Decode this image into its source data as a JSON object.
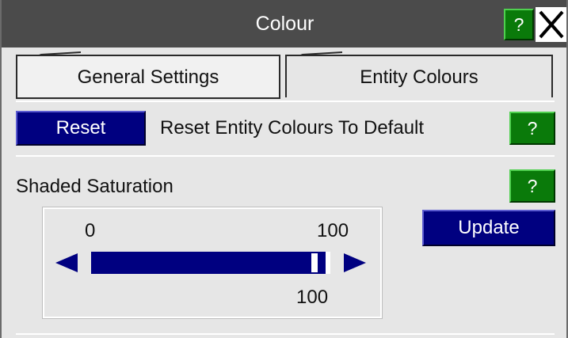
{
  "window": {
    "title": "Colour",
    "help_label": "?",
    "close_icon": "close-icon"
  },
  "tabs": [
    {
      "label": "General Settings",
      "active": false
    },
    {
      "label": "Entity Colours",
      "active": true
    }
  ],
  "reset_row": {
    "button_label": "Reset",
    "description": "Reset Entity Colours To Default",
    "help_label": "?"
  },
  "shaded": {
    "label": "Shaded Saturation",
    "help_label": "?",
    "update_label": "Update",
    "slider": {
      "min_label": "0",
      "max_label": "100",
      "value_label": "100",
      "min": 0,
      "max": 100,
      "value": 100
    }
  },
  "colors": {
    "titlebar": "#4b4b4b",
    "panel": "#e6e6e6",
    "button_blue": "#000080",
    "help_green": "#0a7a0a"
  }
}
